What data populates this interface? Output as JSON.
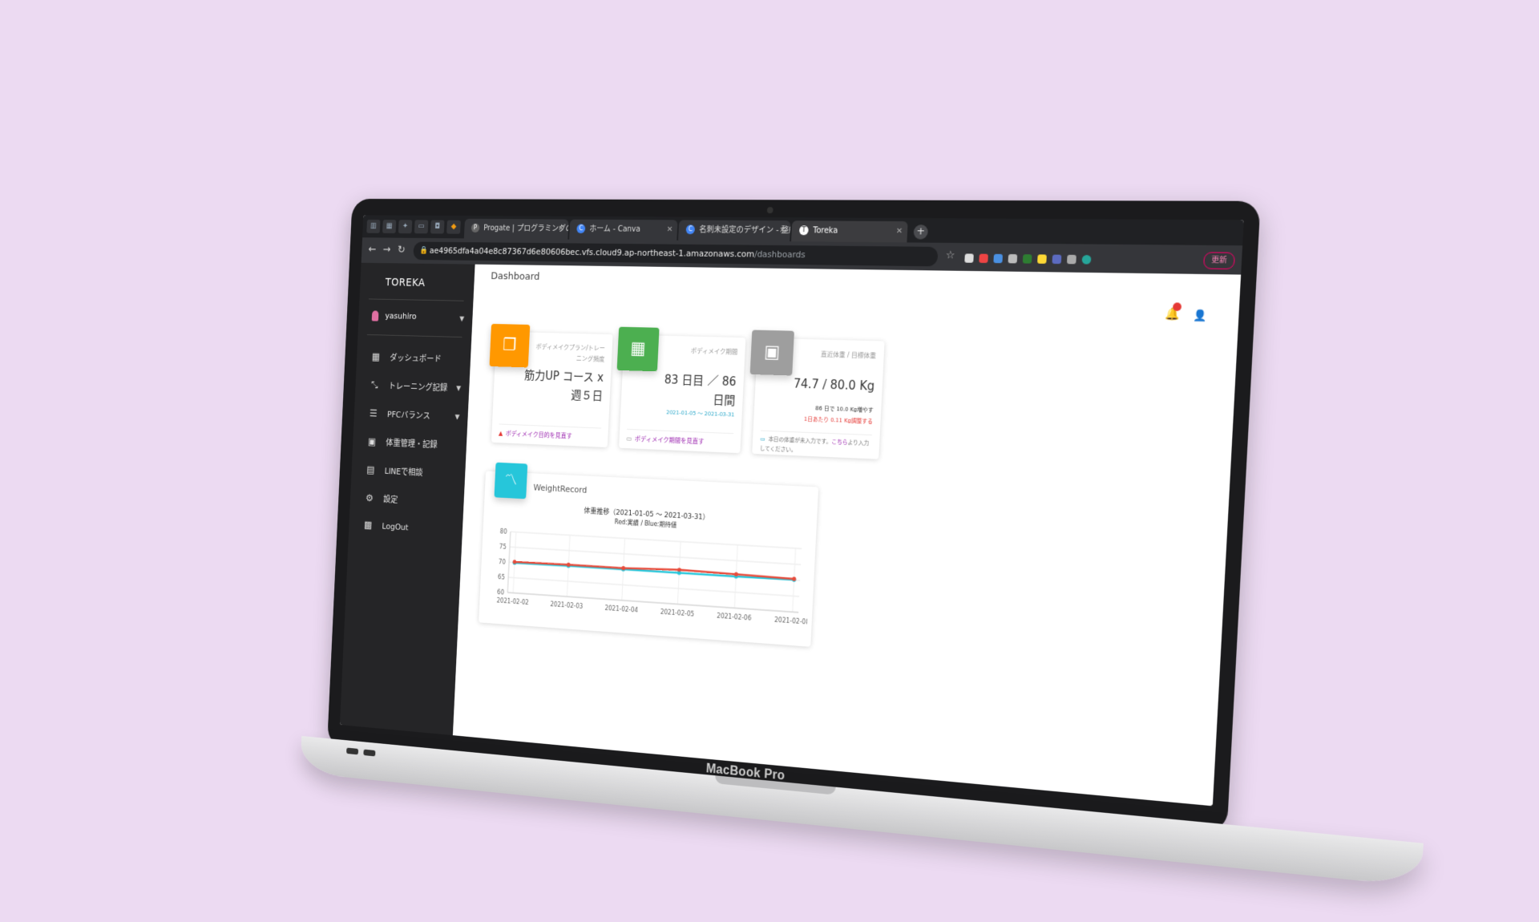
{
  "browser": {
    "tabs": [
      {
        "label": "Progate | プログラミングの入門…",
        "favicon": "P"
      },
      {
        "label": "ホーム - Canva",
        "favicon": "C"
      },
      {
        "label": "名刺未設定のデザイン - 整紙 (デ…",
        "favicon": "C"
      },
      {
        "label": "Toreka",
        "favicon": "T"
      }
    ],
    "url_host": "ae4965dfa4a04e8c87367d6e80606bec.vfs.cloud9.ap-northeast-1.amazonaws.com",
    "url_path": "/dashboards",
    "update_label": "更新"
  },
  "sidebar": {
    "logo": "TOREKA",
    "user": "yasuhiro",
    "items": [
      {
        "label": "ダッシュボード",
        "icon": "dashboard-icon"
      },
      {
        "label": "トレーニング記録",
        "icon": "expand-icon"
      },
      {
        "label": "PFCバランス",
        "icon": "food-icon"
      },
      {
        "label": "体重管理・記録",
        "icon": "scale-icon"
      },
      {
        "label": "LINEで相談",
        "icon": "chat-icon"
      },
      {
        "label": "設定",
        "icon": "gear-icon"
      },
      {
        "label": "LogOut",
        "icon": "logout-icon"
      }
    ]
  },
  "page": {
    "title": "Dashboard"
  },
  "cards": [
    {
      "category": "ボディメイクプラン/トレーニング頻度",
      "value_line1": "筋力UP コース x",
      "value_line2": "週５日",
      "sub": "",
      "footer": "ボディメイク目的を見直す",
      "color": "#ff9800"
    },
    {
      "category": "ボディメイク期間",
      "value_line1": "83 日目 ／ 86",
      "value_line2": "日間",
      "sub": "2021-01-05 ～ 2021-03-31",
      "footer": "ボディメイク期間を見直す",
      "color": "#4caf50"
    },
    {
      "category": "直近体重 / 目標体重",
      "value_line1": "74.7 / 80.0 Kg",
      "value_line2": "",
      "sub": "86 日で 10.0 Kg増やす",
      "sub2": "1日あたり 0.11 Kg調整する",
      "footer_prefix": "本日の体重が未入力です。",
      "footer_link": "こちら",
      "footer_suffix": "より入力してください。",
      "color": "#9e9e9e"
    }
  ],
  "weight_card": {
    "label": "WeightRecord",
    "icon": "trend-icon"
  },
  "chart_data": {
    "type": "line",
    "title": "体重推移（2021-01-05 ～ 2021-03-31）",
    "subtitle": "Red:実績 / Blue:期待値",
    "x": [
      "2021-02-02",
      "2021-02-03",
      "2021-02-04",
      "2021-02-05",
      "2021-02-06",
      "2021-02-08"
    ],
    "series": [
      {
        "name": "実績",
        "color": "#e74c3c",
        "values": [
          70.2,
          70.4,
          70.4,
          71.0,
          70.7,
          70.4
        ]
      },
      {
        "name": "期待値",
        "color": "#26c6da",
        "values": [
          69.9,
          70.0,
          70.0,
          70.0,
          70.0,
          70.1
        ]
      }
    ],
    "yticks": [
      80,
      75,
      70,
      65,
      60
    ],
    "ylim": [
      60,
      80
    ],
    "grid": true
  },
  "device": {
    "brand": "MacBook Pro"
  }
}
